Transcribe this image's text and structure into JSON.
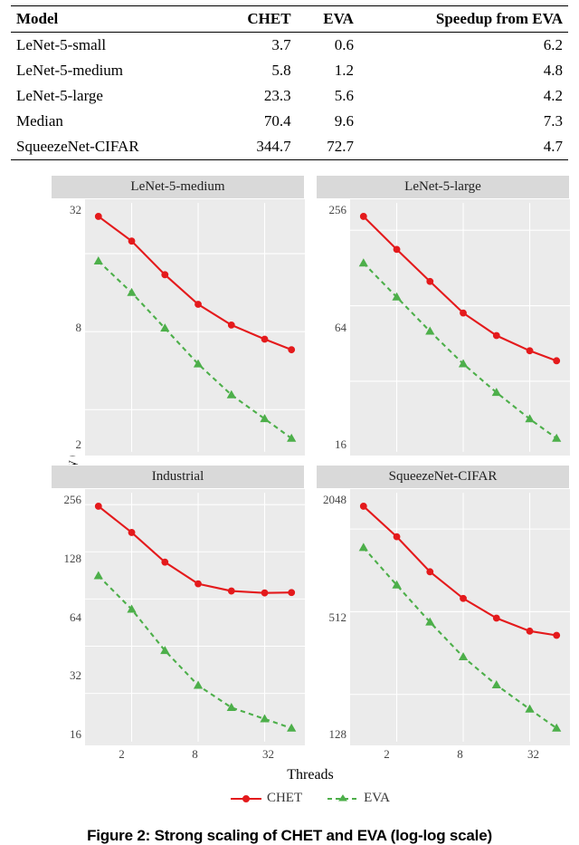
{
  "table": {
    "headers": {
      "model": "Model",
      "chet": "CHET",
      "eva": "EVA",
      "speedup": "Speedup from EVA"
    },
    "rows": [
      {
        "model": "LeNet-5-small",
        "chet": "3.7",
        "eva": "0.6",
        "speedup": "6.2"
      },
      {
        "model": "LeNet-5-medium",
        "chet": "5.8",
        "eva": "1.2",
        "speedup": "4.8"
      },
      {
        "model": "LeNet-5-large",
        "chet": "23.3",
        "eva": "5.6",
        "speedup": "4.2"
      },
      {
        "model": "Median",
        "chet": "70.4",
        "eva": "9.6",
        "speedup": "7.3"
      },
      {
        "model": "SqueezeNet-CIFAR",
        "chet": "344.7",
        "eva": "72.7",
        "speedup": "4.7"
      }
    ]
  },
  "chart": {
    "ylabel": "Average Latency (sec)",
    "xlabel": "Threads",
    "legend": {
      "chet": "CHET",
      "eva": "EVA"
    },
    "panels": [
      {
        "title": "LeNet-5-medium",
        "yticks": [
          "32",
          "8",
          "2"
        ]
      },
      {
        "title": "LeNet-5-large",
        "yticks": [
          "256",
          "64",
          "16"
        ]
      },
      {
        "title": "Industrial",
        "yticks": [
          "256",
          "128",
          "64",
          "32",
          "16"
        ]
      },
      {
        "title": "SqueezeNet-CIFAR",
        "yticks": [
          "2048",
          "512",
          "128"
        ]
      }
    ],
    "xticks": [
      "2",
      "8",
      "32"
    ]
  },
  "caption": "Figure 2: Strong scaling of CHET and EVA (log-log scale)",
  "chart_data": [
    {
      "title": "LeNet-5-medium",
      "type": "line",
      "xlabel": "Threads",
      "ylabel": "Average Latency (sec)",
      "x": [
        1,
        2,
        4,
        8,
        16,
        32,
        56
      ],
      "series": [
        {
          "name": "CHET",
          "values": [
            62,
            40,
            22,
            13,
            9.0,
            7.0,
            5.8
          ]
        },
        {
          "name": "EVA",
          "values": [
            28,
            16,
            8.5,
            4.5,
            2.6,
            1.7,
            1.2
          ]
        }
      ],
      "yscale": "log",
      "xscale": "log",
      "yticks": [
        2,
        8,
        32
      ]
    },
    {
      "title": "LeNet-5-large",
      "type": "line",
      "xlabel": "Threads",
      "ylabel": "Average Latency (sec)",
      "x": [
        1,
        2,
        4,
        8,
        16,
        32,
        56
      ],
      "series": [
        {
          "name": "CHET",
          "values": [
            330,
            180,
            100,
            56,
            37,
            28,
            23.3
          ]
        },
        {
          "name": "EVA",
          "values": [
            140,
            75,
            40,
            22,
            13,
            8.0,
            5.6
          ]
        }
      ],
      "yscale": "log",
      "xscale": "log",
      "yticks": [
        16,
        64,
        256
      ]
    },
    {
      "title": "Industrial",
      "type": "line",
      "xlabel": "Threads",
      "ylabel": "Average Latency (sec)",
      "x": [
        1,
        2,
        4,
        8,
        16,
        32,
        56
      ],
      "series": [
        {
          "name": "CHET",
          "values": [
            250,
            170,
            110,
            80,
            72,
            70,
            70.4
          ]
        },
        {
          "name": "EVA",
          "values": [
            90,
            55,
            30,
            18,
            13,
            11,
            9.6
          ]
        }
      ],
      "yscale": "log",
      "xscale": "log",
      "yticks": [
        16,
        32,
        64,
        128,
        256
      ]
    },
    {
      "title": "SqueezeNet-CIFAR",
      "type": "line",
      "xlabel": "Threads",
      "ylabel": "Average Latency (sec)",
      "x": [
        1,
        2,
        4,
        8,
        16,
        32,
        56
      ],
      "series": [
        {
          "name": "CHET",
          "values": [
            3000,
            1800,
            1000,
            640,
            460,
            370,
            344.7
          ]
        },
        {
          "name": "EVA",
          "values": [
            1500,
            800,
            430,
            240,
            150,
            100,
            72.7
          ]
        }
      ],
      "yscale": "log",
      "xscale": "log",
      "yticks": [
        128,
        512,
        2048
      ]
    }
  ]
}
